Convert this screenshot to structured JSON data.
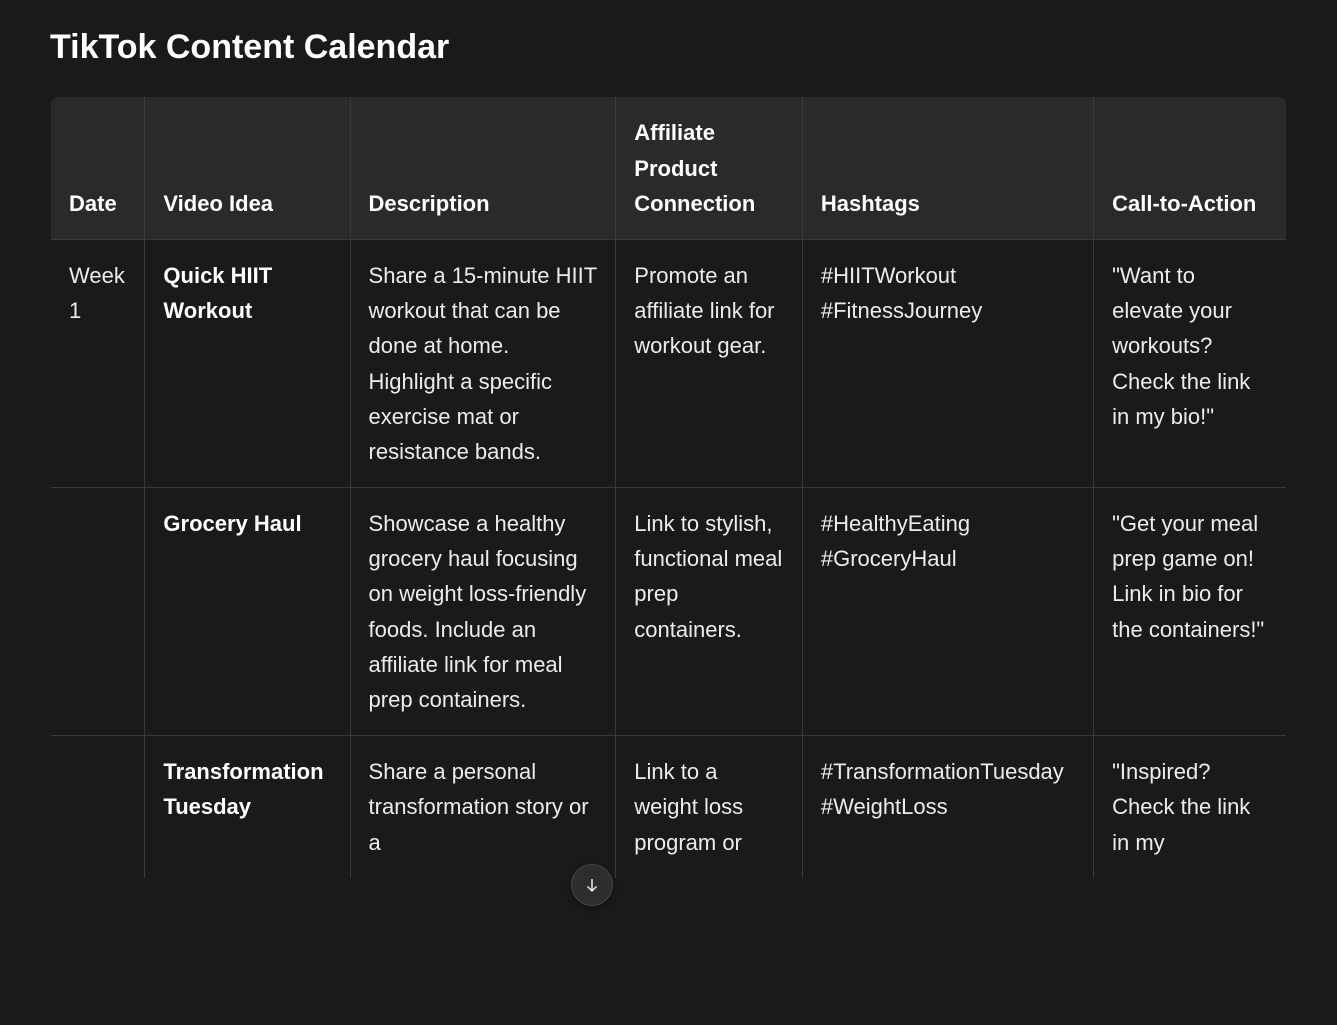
{
  "title": "TikTok Content Calendar",
  "columns": [
    "Date",
    "Video Idea",
    "Description",
    "Affiliate Product Connection",
    "Hashtags",
    "Call-to-Action"
  ],
  "rows": [
    {
      "date": "Week 1",
      "idea": "Quick HIIT Workout",
      "description": "Share a 15-minute HIIT workout that can be done at home. Highlight a specific exercise mat or resistance bands.",
      "affiliate": "Promote an affiliate link for workout gear.",
      "hashtags": "#HIITWorkout #FitnessJourney",
      "cta": "\"Want to elevate your workouts? Check the link in my bio!\""
    },
    {
      "date": "",
      "idea": "Grocery Haul",
      "description": "Showcase a healthy grocery haul focusing on weight loss-friendly foods. Include an affiliate link for meal prep containers.",
      "affiliate": "Link to stylish, functional meal prep containers.",
      "hashtags": "#HealthyEating #GroceryHaul",
      "cta": "\"Get your meal prep game on! Link in bio for the containers!\""
    },
    {
      "date": "",
      "idea": "Transformation Tuesday",
      "description": "Share a personal transformation story or a",
      "affiliate": "Link to a weight loss program or",
      "hashtags": "#TransformationTuesday #WeightLoss",
      "cta": "\"Inspired? Check the link in my"
    }
  ],
  "scroll_button": {
    "icon": "arrow-down-icon",
    "label": "Scroll down"
  }
}
